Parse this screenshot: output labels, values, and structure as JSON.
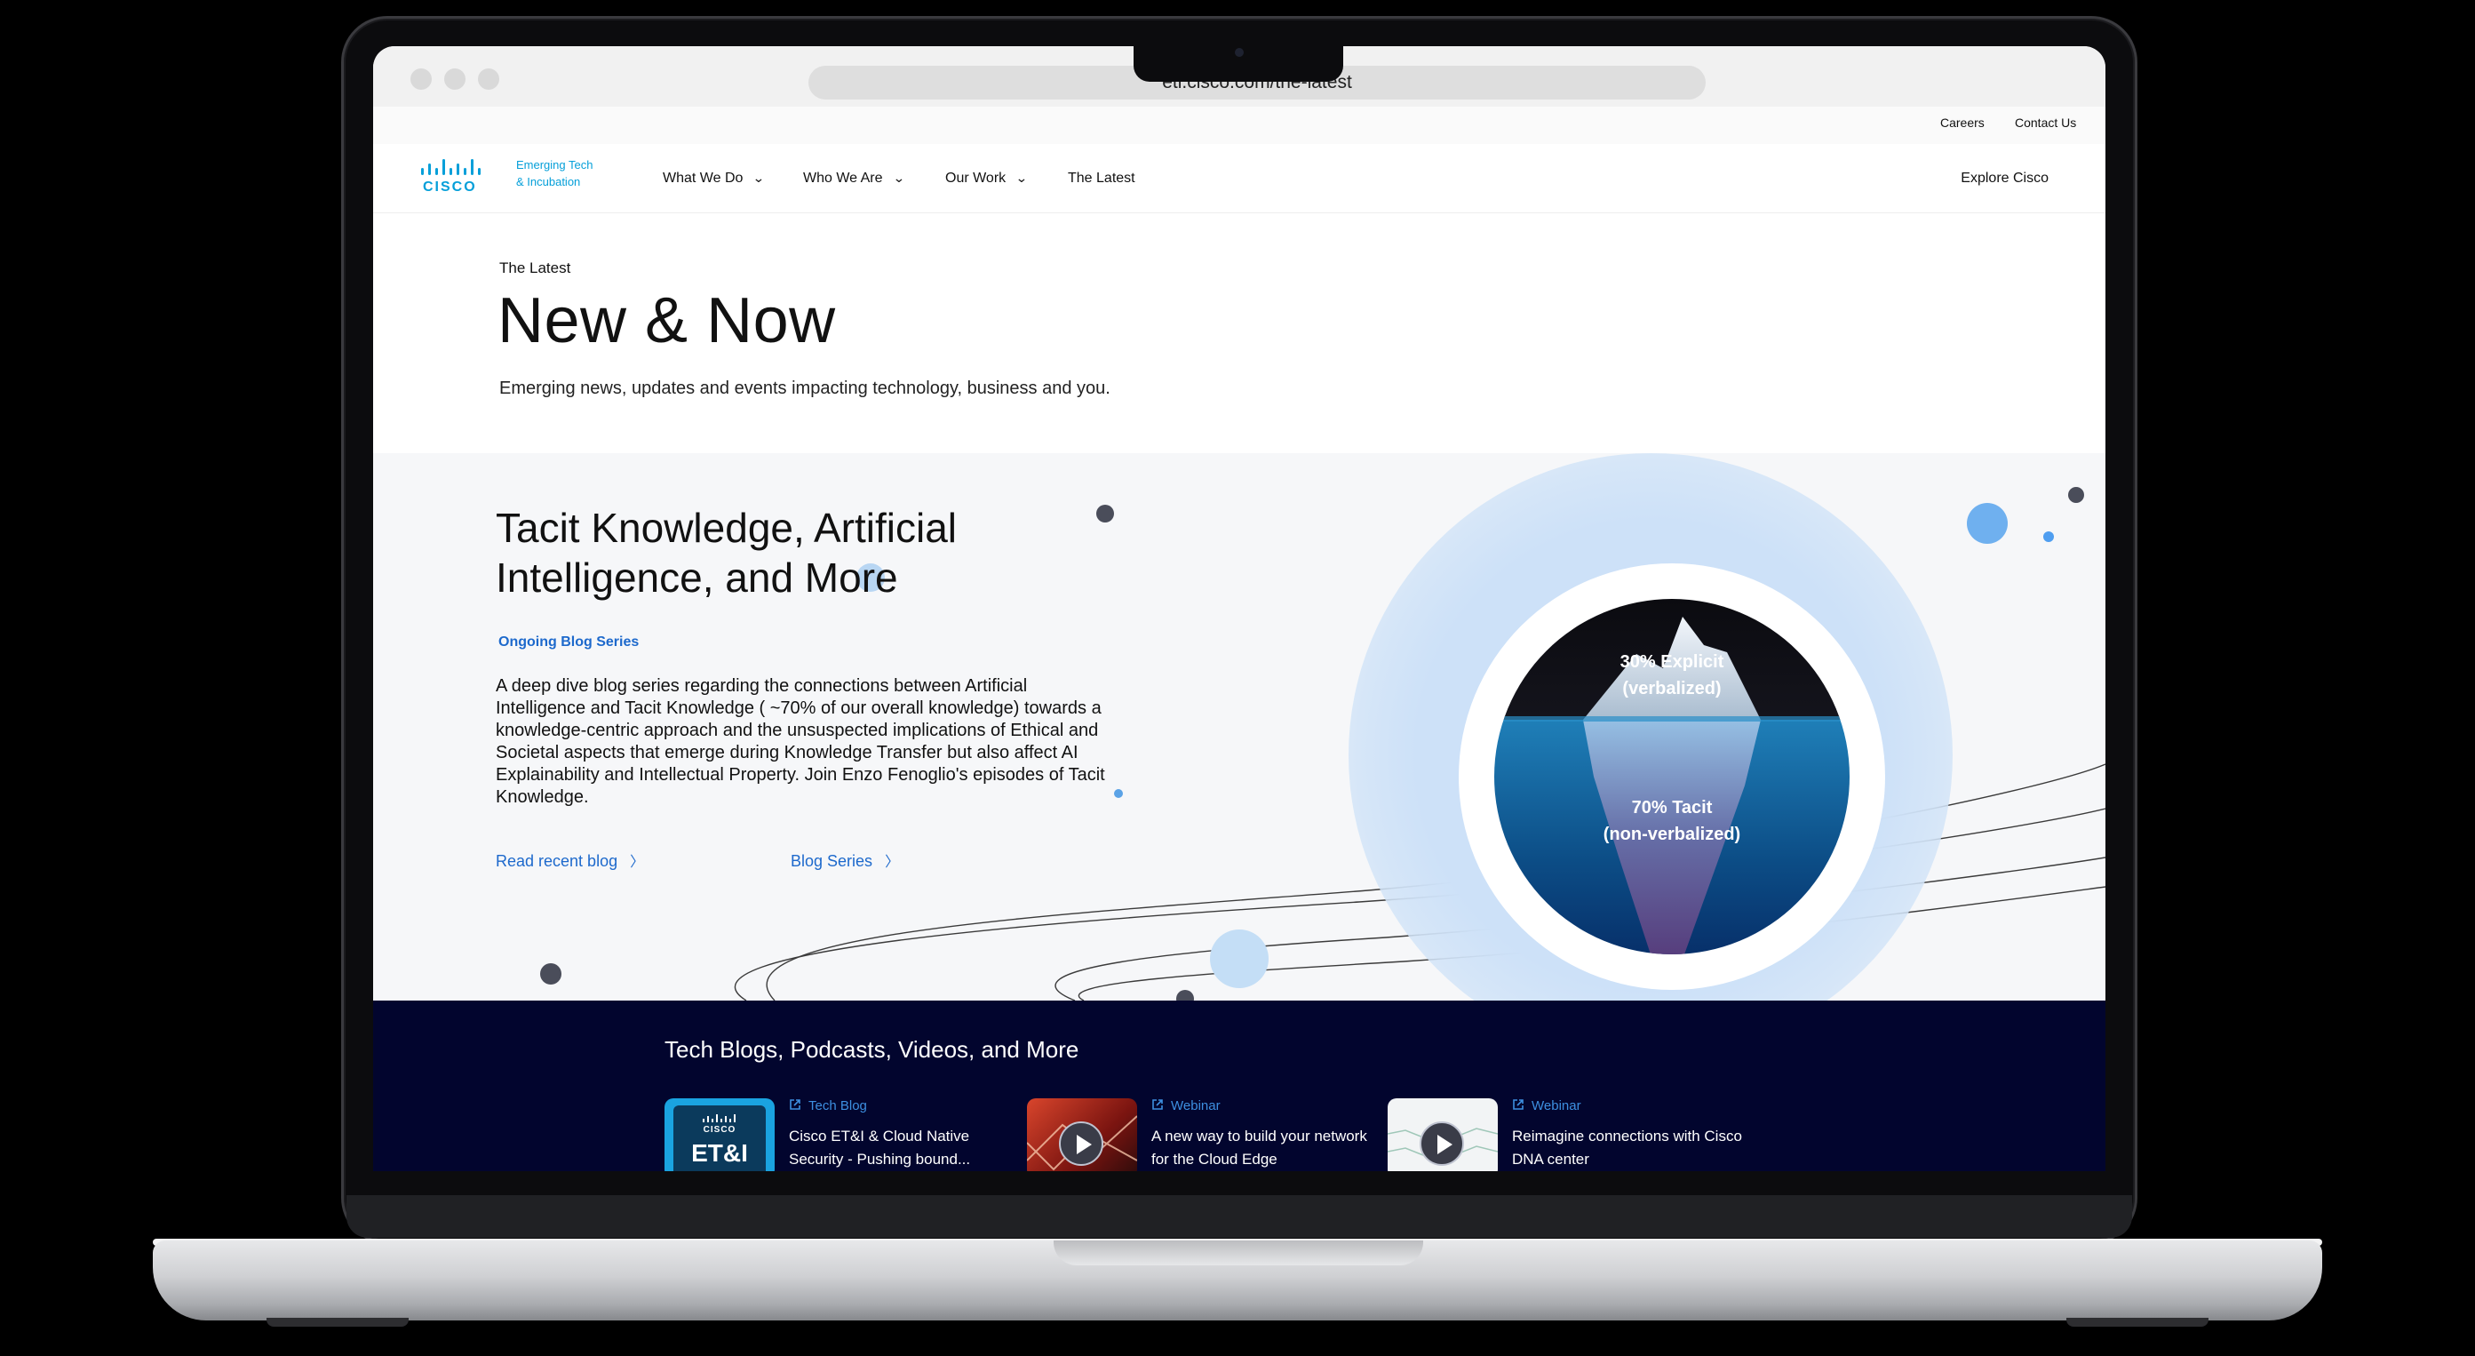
{
  "browser": {
    "url": "eti.cisco.com/the-latest"
  },
  "util_nav": {
    "careers": "Careers",
    "contact": "Contact Us"
  },
  "brand": {
    "logo_text": "CISCO",
    "tagline_line1": "Emerging Tech",
    "tagline_line2": "& Incubation",
    "color": "#049fd9"
  },
  "nav": {
    "items": [
      {
        "label": "What We Do",
        "has_dropdown": true
      },
      {
        "label": "Who We Are",
        "has_dropdown": true
      },
      {
        "label": "Our Work",
        "has_dropdown": true
      },
      {
        "label": "The Latest",
        "has_dropdown": false
      }
    ],
    "explore": "Explore Cisco"
  },
  "hero": {
    "eyebrow": "The Latest",
    "title": "New & Now",
    "subtitle": "Emerging news, updates and events impacting technology, business and you."
  },
  "feature": {
    "title": "Tacit Knowledge, Artificial Intelligence, and More",
    "badge": "Ongoing Blog Series",
    "body": "A deep dive blog series regarding the connections between Artificial Intelligence and Tacit Knowledge ( ~70% of our overall knowledge) towards a knowledge-centric approach and the unsuspected implications of Ethical and Societal aspects that emerge during Knowledge Transfer but also affect AI Explainability and Intellectual Property. Join Enzo Fenoglio's episodes of Tacit Knowledge.",
    "link1": "Read recent blog",
    "link2": "Blog Series",
    "image": {
      "label_top_line1": "30% Explicit",
      "label_top_line2": "(verbalized)",
      "label_bottom_line1": "70% Tacit",
      "label_bottom_line2": "(non-verbalized)"
    },
    "accent_color": "#1d69cc"
  },
  "blogs": {
    "title": "Tech Blogs, Podcasts, Videos, and More",
    "background": "#02052e",
    "cards": [
      {
        "tag": "Tech Blog",
        "text": "Cisco ET&I & Cloud Native Security - Pushing bound...",
        "thumb_brand": "CISCO",
        "thumb_title": "ET&I",
        "icon": "external-link-icon"
      },
      {
        "tag": "Webinar",
        "text": "A new way to build your network for the Cloud Edge",
        "icon": "external-link-icon"
      },
      {
        "tag": "Webinar",
        "text": "Reimagine connections with Cisco DNA center",
        "icon": "external-link-icon"
      }
    ]
  }
}
